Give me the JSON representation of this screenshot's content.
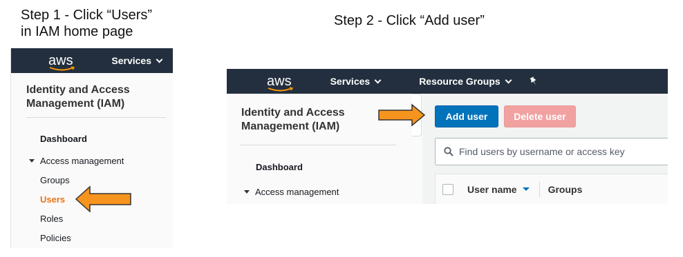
{
  "steps": {
    "step1_line1": "Step 1 - Click “Users”",
    "step1_line2": "in IAM home page",
    "step2": "Step 2 - Click “Add user”"
  },
  "colors": {
    "aws_nav": "#232f3e",
    "arrow": "#f7941d",
    "active_link": "#ec7211",
    "primary_button": "#0073bb",
    "danger_button_disabled": "#f2a1a1"
  },
  "panel1": {
    "logo": "aws",
    "services": "Services",
    "title": "Identity and Access Management (IAM)",
    "nav": {
      "dashboard": "Dashboard",
      "access_management": "Access management",
      "groups": "Groups",
      "users": "Users",
      "roles": "Roles",
      "policies": "Policies"
    }
  },
  "panel2": {
    "logo": "aws",
    "services": "Services",
    "resource_groups": "Resource Groups",
    "title": "Identity and Access Management (IAM)",
    "nav": {
      "dashboard": "Dashboard",
      "access_management": "Access management"
    },
    "buttons": {
      "add_user": "Add user",
      "delete_user": "Delete user"
    },
    "search": {
      "placeholder": "Find users by username or access key"
    },
    "table": {
      "columns": [
        "User name",
        "Groups"
      ]
    }
  }
}
